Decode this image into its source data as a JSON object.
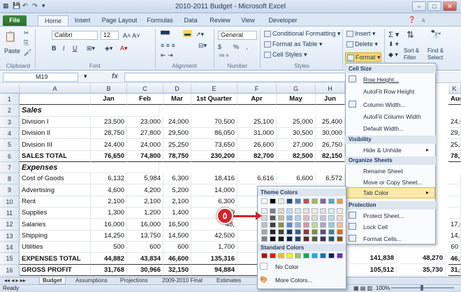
{
  "window": {
    "title": "2010-2011 Budget - Microsoft Excel",
    "controls": [
      "–",
      "□",
      "✕"
    ]
  },
  "ribbon_tabs": [
    "File",
    "Home",
    "Insert",
    "Page Layout",
    "Formulas",
    "Data",
    "Review",
    "View",
    "Developer"
  ],
  "ribbon": {
    "clipboard": {
      "paste": "Paste",
      "label": "Clipboard"
    },
    "font": {
      "name": "Calibri",
      "size": "12",
      "bold": "B",
      "italic": "I",
      "underline": "U",
      "label": "Font"
    },
    "alignment": {
      "label": "Alignment"
    },
    "number": {
      "format": "General",
      "currency": "$",
      "percent": "%",
      "label": "Number"
    },
    "styles": {
      "conditional": "Conditional Formatting",
      "table": "Format as Table",
      "cell": "Cell Styles",
      "label": "Styles"
    },
    "cells": {
      "insert": "Insert",
      "delete": "Delete",
      "format": "Format"
    },
    "editing": {
      "sort": "Sort &",
      "filter": "Filter",
      "find": "Find &",
      "select": "Select"
    }
  },
  "formula_bar": {
    "name_box": "M19",
    "fx": "fx",
    "value": ""
  },
  "columns": [
    "A",
    "B",
    "C",
    "D",
    "E",
    "F",
    "G",
    "H",
    "K"
  ],
  "rows": [
    {
      "n": "1",
      "type": "header",
      "cells": [
        "",
        "Jan",
        "Feb",
        "Mar",
        "1st Quarter",
        "Apr",
        "May",
        "Jun",
        "",
        "Aug"
      ]
    },
    {
      "n": "2",
      "type": "section",
      "cells": [
        "Sales"
      ]
    },
    {
      "n": "3",
      "type": "data",
      "cells": [
        "Division I",
        "23,500",
        "23,000",
        "24,000",
        "70,500",
        "25,100",
        "25,000",
        "25,400",
        "",
        "24,0"
      ]
    },
    {
      "n": "4",
      "type": "data",
      "cells": [
        "Division II",
        "28,750",
        "27,800",
        "29,500",
        "86,050",
        "31,000",
        "30,500",
        "30,000",
        "",
        "29,5"
      ]
    },
    {
      "n": "5",
      "type": "data",
      "cells": [
        "Division III",
        "24,400",
        "24,000",
        "25,250",
        "73,650",
        "26,600",
        "27,000",
        "26,750",
        "",
        "25,2"
      ]
    },
    {
      "n": "6",
      "type": "total",
      "cells": [
        "SALES TOTAL",
        "76,650",
        "74,800",
        "78,750",
        "230,200",
        "82,700",
        "82,500",
        "82,150",
        "",
        "78,7"
      ]
    },
    {
      "n": "7",
      "type": "section",
      "cells": [
        "Expenses"
      ]
    },
    {
      "n": "8",
      "type": "data",
      "cells": [
        "Cost of Goods",
        "6,132",
        "5,984",
        "6,300",
        "18,416",
        "6,616",
        "6,600",
        "6,572",
        "",
        ""
      ]
    },
    {
      "n": "9",
      "type": "data",
      "cells": [
        "Advertising",
        "4,600",
        "4,200",
        "5,200",
        "14,000",
        "5,0",
        "",
        "",
        "",
        ""
      ]
    },
    {
      "n": "10",
      "type": "data",
      "cells": [
        "Rent",
        "2,100",
        "2,100",
        "2,100",
        "6,300",
        "2,1",
        "",
        "",
        "",
        ""
      ]
    },
    {
      "n": "11",
      "type": "data",
      "cells": [
        "Supplies",
        "1,300",
        "1,200",
        "1,400",
        "3,9",
        "",
        "",
        "",
        "",
        ""
      ]
    },
    {
      "n": "12",
      "type": "data",
      "cells": [
        "Salaries",
        "16,000",
        "16,000",
        "16,500",
        "48,",
        "",
        "",
        "",
        "",
        "17,0"
      ]
    },
    {
      "n": "13",
      "type": "data",
      "cells": [
        "Shipping",
        "14,250",
        "13,750",
        "14,500",
        "42,500",
        "",
        "",
        "",
        "",
        "14,5"
      ]
    },
    {
      "n": "14",
      "type": "data",
      "cells": [
        "Utilities",
        "500",
        "600",
        "600",
        "1,700",
        "5",
        "",
        "",
        "",
        "60"
      ]
    },
    {
      "n": "15",
      "type": "total",
      "cells": [
        "EXPENSES TOTAL",
        "44,882",
        "43,834",
        "46,600",
        "135,316",
        "47,",
        "",
        "",
        "",
        "46,9"
      ]
    },
    {
      "n": "16",
      "type": "total",
      "cells": [
        "GROSS PROFIT",
        "31,768",
        "30,966",
        "32,150",
        "94,884",
        "35,",
        "",
        "",
        "",
        "31,6"
      ]
    }
  ],
  "hidden_cols_values": {
    "row15": [
      "141,838",
      "48,270"
    ],
    "row16": [
      "105,512",
      "35,730"
    ]
  },
  "sheet_tabs": [
    "Budget",
    "Assumptions",
    "Projections",
    "2009-2010 Final",
    "Estimates"
  ],
  "status": {
    "ready": "Ready",
    "zoom": "100%"
  },
  "format_menu": {
    "cell_size": "Cell Size",
    "row_height": "Row Height...",
    "autofit_row": "AutoFit Row Height",
    "column_width": "Column Width...",
    "autofit_col": "AutoFit Column Width",
    "default_width": "Default Width...",
    "visibility": "Visibility",
    "hide_unhide": "Hide & Unhide",
    "organize": "Organize Sheets",
    "rename": "Rename Sheet",
    "move_copy": "Move or Copy Sheet...",
    "tab_color": "Tab Color",
    "protection": "Protection",
    "protect": "Protect Sheet...",
    "lock": "Lock Cell",
    "format_cells": "Format Cells..."
  },
  "palette": {
    "theme_title": "Theme Colors",
    "standard_title": "Standard Colors",
    "no_color": "No Color",
    "more_colors": "More Colors...",
    "theme_top": [
      "#ffffff",
      "#000000",
      "#eeece1",
      "#1f497d",
      "#4f81bd",
      "#c0504d",
      "#9bbb59",
      "#8064a2",
      "#4bacc6",
      "#f79646"
    ],
    "theme_shades": [
      [
        "#f2f2f2",
        "#7f7f7f",
        "#ddd9c3",
        "#c6d9f0",
        "#dbe5f1",
        "#f2dcdb",
        "#ebf1dd",
        "#e5e0ec",
        "#dbeef3",
        "#fdeada"
      ],
      [
        "#d8d8d8",
        "#595959",
        "#c4bd97",
        "#8db3e2",
        "#b8cce4",
        "#e5b9b7",
        "#d7e3bc",
        "#ccc1d9",
        "#b7dde8",
        "#fbd5b5"
      ],
      [
        "#bfbfbf",
        "#3f3f3f",
        "#938953",
        "#548dd4",
        "#95b3d7",
        "#d99694",
        "#c3d69b",
        "#b2a2c7",
        "#92cddc",
        "#fac08f"
      ],
      [
        "#a5a5a5",
        "#262626",
        "#494429",
        "#17365d",
        "#366092",
        "#953734",
        "#76923c",
        "#5f497a",
        "#31859b",
        "#e36c09"
      ],
      [
        "#7f7f7f",
        "#0c0c0c",
        "#1d1b10",
        "#0f243e",
        "#244061",
        "#632423",
        "#4f6128",
        "#3f3151",
        "#205867",
        "#974806"
      ]
    ],
    "standard": [
      "#c00000",
      "#ff0000",
      "#ffc000",
      "#ffff00",
      "#92d050",
      "#00b050",
      "#00b0f0",
      "#0070c0",
      "#002060",
      "#7030a0"
    ]
  },
  "callout": {
    "number": "٥",
    "color": "#d2232a"
  }
}
